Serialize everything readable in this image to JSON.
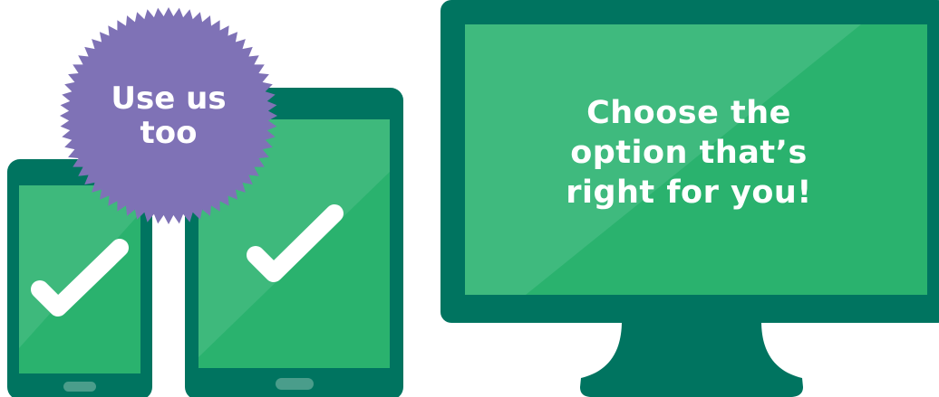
{
  "badge": {
    "line1": "Use us",
    "line2": "too"
  },
  "monitor": {
    "line1": "Choose the",
    "line2": "option that’s",
    "line3": "right for you!"
  },
  "icons": {
    "phone": "phone-icon",
    "tablet": "tablet-icon",
    "monitor": "monitor-icon",
    "checkmark": "checkmark-icon",
    "badge": "starburst-badge-icon"
  },
  "colors": {
    "device_frame": "#007460",
    "screen_green": "#2ab26e",
    "screen_highlight": "#4fc088",
    "home_button": "#4a9d8b",
    "badge_purple": "#7f72b6",
    "text": "#ffffff"
  }
}
